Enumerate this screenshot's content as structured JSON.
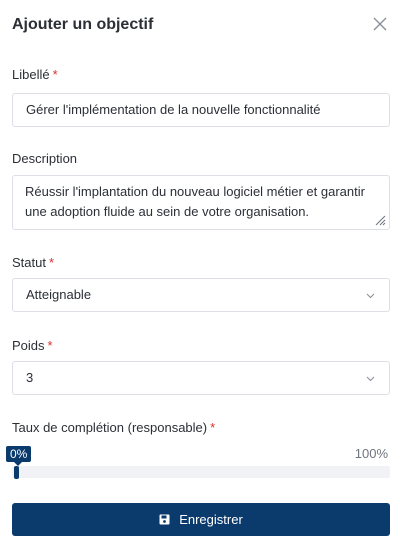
{
  "dialog": {
    "title": "Ajouter un objectif"
  },
  "form": {
    "libelle": {
      "label": "Libellé",
      "required_mark": "*",
      "value": "Gérer l'implémentation de la nouvelle fonctionnalité"
    },
    "description": {
      "label": "Description",
      "value": "Réussir l'implantation du nouveau logiciel métier et garantir une adoption fluide au sein de votre organisation."
    },
    "statut": {
      "label": "Statut",
      "required_mark": "*",
      "value": "Atteignable"
    },
    "poids": {
      "label": "Poids",
      "required_mark": "*",
      "value": "3"
    },
    "taux": {
      "label": "Taux de complétion (responsable)",
      "required_mark": "*",
      "current_label": "0%",
      "max_label": "100%",
      "value_percent": 0
    }
  },
  "actions": {
    "save_label": "Enregistrer",
    "save_icon": "floppy-disk-icon"
  },
  "colors": {
    "primary": "#0b3a6c",
    "required": "#d9302b",
    "border": "#dcdfe5"
  }
}
